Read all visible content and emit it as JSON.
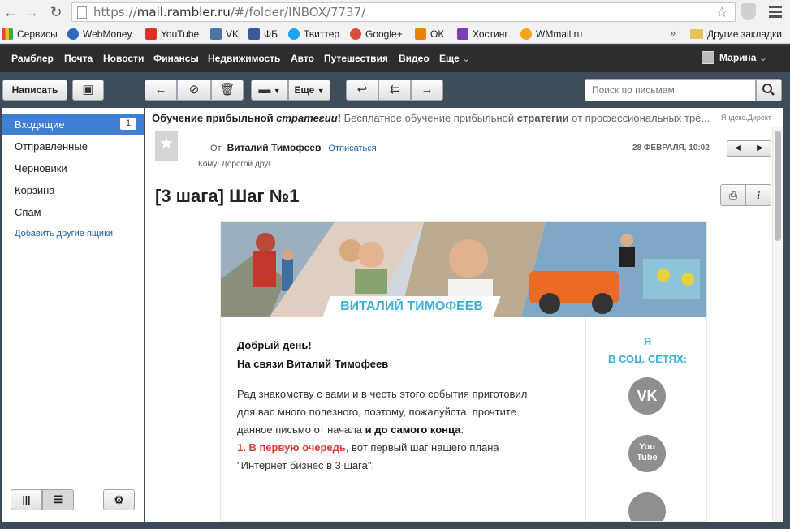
{
  "browser": {
    "url_scheme": "https://",
    "url_host": "mail.rambler.ru",
    "url_path": "/#/folder/INBOX/7737/",
    "bookmarks": [
      {
        "label": "Сервисы",
        "color": "#ea4335"
      },
      {
        "label": "WebMoney",
        "color": "#2c6bbd"
      },
      {
        "label": "YouTube",
        "color": "#e52d27"
      },
      {
        "label": "VK",
        "color": "#4c75a3"
      },
      {
        "label": "ФБ",
        "color": "#3b5998"
      },
      {
        "label": "Твиттер",
        "color": "#1da1f2"
      },
      {
        "label": "Google+",
        "color": "#dd4b39"
      },
      {
        "label": "OK",
        "color": "#ee8208"
      },
      {
        "label": "Хостинг",
        "color": "#7b3fb7"
      },
      {
        "label": "WMmail.ru",
        "color": "#f2a51a"
      }
    ],
    "more_bookmarks": "»",
    "other_bookmarks": "Другие закладки"
  },
  "rambler_nav": {
    "items": [
      "Рамблер",
      "Почта",
      "Новости",
      "Финансы",
      "Недвижимость",
      "Авто",
      "Путешествия",
      "Видео",
      "Еще"
    ],
    "user_name": "Марина"
  },
  "toolbar": {
    "compose_label": "Написать",
    "more_label": "Еще",
    "search_placeholder": "Поиск по письмам"
  },
  "sidebar": {
    "folders": [
      {
        "label": "Входящие",
        "count": "1"
      },
      {
        "label": "Отправленные"
      },
      {
        "label": "Черновики"
      },
      {
        "label": "Корзина"
      },
      {
        "label": "Спам"
      }
    ],
    "add_boxes": "Добавить другие ящики"
  },
  "ad": {
    "title_part1": "Обучение прибыльной ",
    "title_part2": "стратегии",
    "title_part3": "!",
    "text_part1": " Бесплатное обучение прибыльной ",
    "text_part2": "стратегии",
    "text_part3": " от профессиональных тре...",
    "label": "Яндекс.Директ"
  },
  "message": {
    "from_prefix": "От",
    "sender": "Виталий Тимофеев",
    "unsubscribe": "Отписаться",
    "to_line": "Кому:  Дорогой друг",
    "date": "28 ФЕВРАЛЯ, 10:02",
    "subject": "[3 шага] Шаг №1",
    "banner_name": "ВИТАЛИЙ ТИМОФЕЕВ",
    "greeting1": "Добрый день!",
    "greeting2": "На связи Виталий Тимофеев",
    "p1_line1": "Рад знакомству с вами и в честь этого события приготовил",
    "p1_line2": "для вас много полезного, поэтому, пожалуйста, прочтите",
    "p1_line3_a": "данное письмо от начала ",
    "p1_line3_b": "и до самого конца",
    "p1_line3_c": ":",
    "step_red": "1. В первую очередь",
    "step_rest": ", вот первый шаг нашего плана",
    "step_line2": "\"Интернет бизнес в 3 шага\":",
    "social_title1": "Я",
    "social_title2": "В СОЦ. СЕТЯХ:",
    "vk_label": "VK",
    "youtube_label1": "You",
    "youtube_label2": "Tube"
  }
}
